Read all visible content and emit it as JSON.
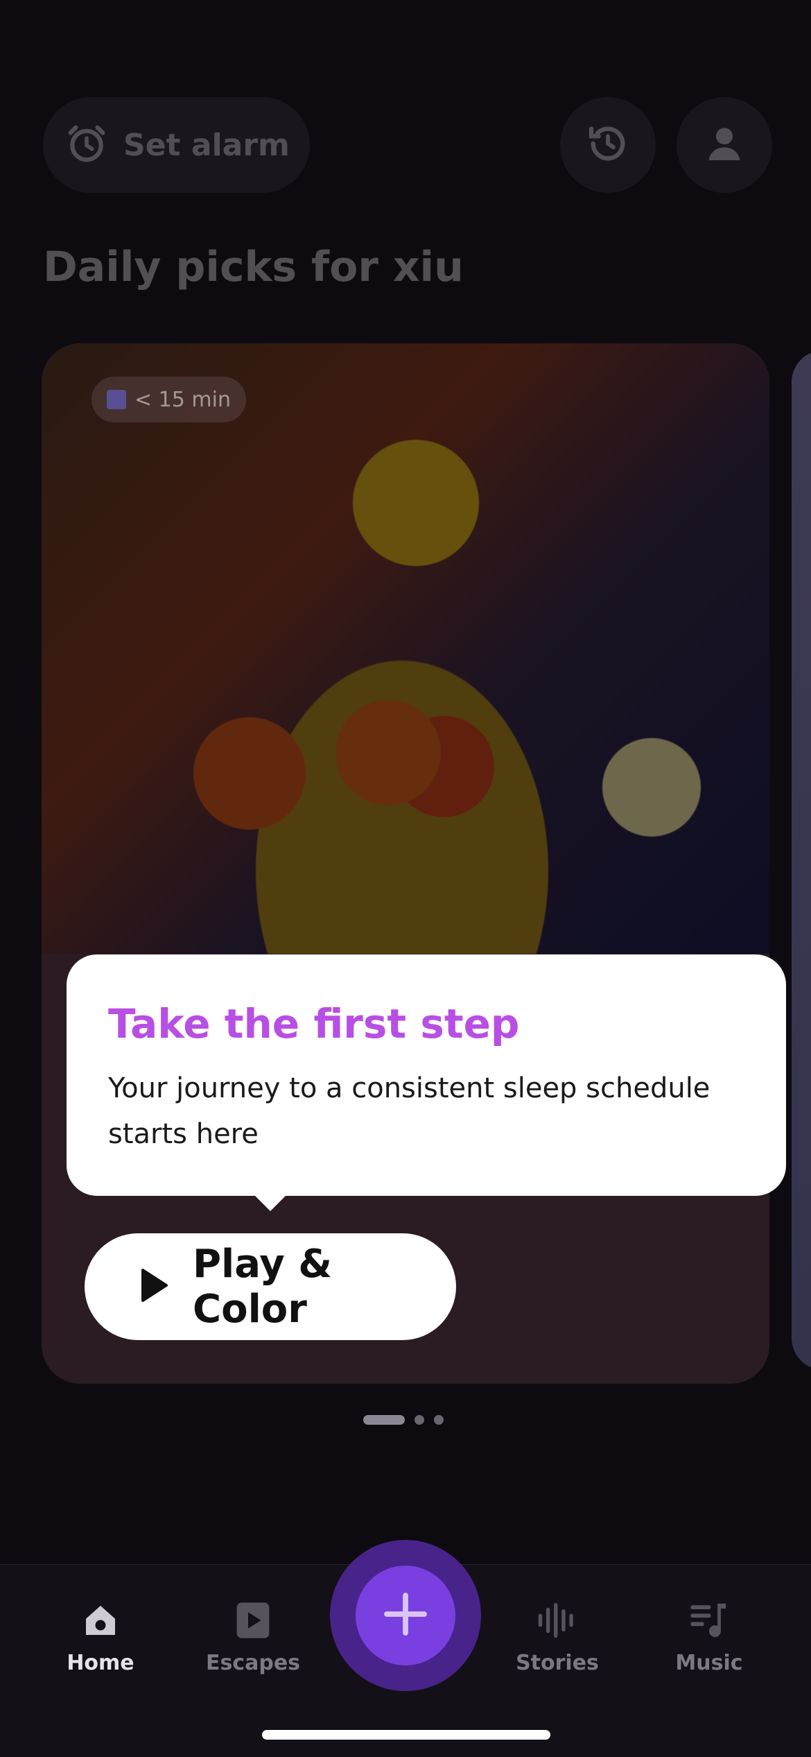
{
  "header": {
    "alarm_label": "Set alarm",
    "history_icon": "history-icon",
    "profile_icon": "profile-icon"
  },
  "section_title": "Daily picks for xiu",
  "card": {
    "duration_badge": "< 15 min",
    "play_label": "Play & Color"
  },
  "tooltip": {
    "title": "Take the first step",
    "body": "Your journey to a consistent sleep schedule starts here"
  },
  "pager": {
    "count": 3,
    "active": 0
  },
  "nav": {
    "items": [
      {
        "label": "Home",
        "icon": "home-icon",
        "active": true
      },
      {
        "label": "Escapes",
        "icon": "play-square-icon",
        "active": false
      },
      {
        "label": "Stories",
        "icon": "waveform-icon",
        "active": false
      },
      {
        "label": "Music",
        "icon": "music-note-icon",
        "active": false
      }
    ],
    "fab_icon": "plus-icon"
  },
  "colors": {
    "accent": "#b84fe4",
    "fab": "#7a3fe0",
    "background": "#0d0b10"
  }
}
